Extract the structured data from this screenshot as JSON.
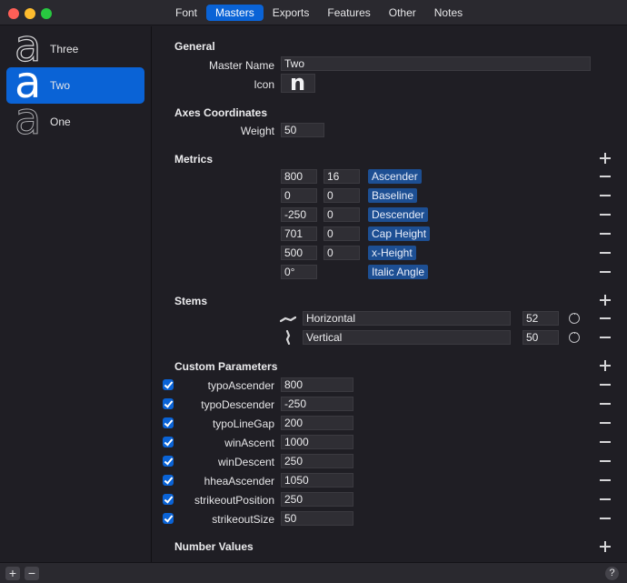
{
  "tabs": [
    {
      "label": "Font"
    },
    {
      "label": "Masters"
    },
    {
      "label": "Exports"
    },
    {
      "label": "Features"
    },
    {
      "label": "Other"
    },
    {
      "label": "Notes"
    }
  ],
  "active_tab": "Masters",
  "masters": [
    {
      "glyph": "a",
      "name": "Three",
      "selected": false
    },
    {
      "glyph": "a",
      "name": "Two",
      "selected": true
    },
    {
      "glyph": "a",
      "name": "One",
      "selected": false
    }
  ],
  "general": {
    "title": "General",
    "master_name_label": "Master Name",
    "master_name_value": "Two",
    "icon_label": "Icon",
    "icon_glyph": "n"
  },
  "axes": {
    "title": "Axes Coordinates",
    "weight_label": "Weight",
    "weight_value": "50"
  },
  "metrics": {
    "title": "Metrics",
    "rows": [
      {
        "value": "800",
        "overshoot": "16",
        "name": "Ascender"
      },
      {
        "value": "0",
        "overshoot": "0",
        "name": "Baseline"
      },
      {
        "value": "-250",
        "overshoot": "0",
        "name": "Descender"
      },
      {
        "value": "701",
        "overshoot": "0",
        "name": "Cap Height"
      },
      {
        "value": "500",
        "overshoot": "0",
        "name": "x-Height"
      },
      {
        "value": "0°",
        "overshoot": null,
        "name": "Italic Angle"
      }
    ]
  },
  "stems": {
    "title": "Stems",
    "rows": [
      {
        "icon": "horizontal-stem-icon",
        "name": "Horizontal",
        "value": "52"
      },
      {
        "icon": "vertical-stem-icon",
        "name": "Vertical",
        "value": "50"
      }
    ]
  },
  "custom_parameters": {
    "title": "Custom Parameters",
    "rows": [
      {
        "checked": true,
        "name": "typoAscender",
        "value": "800"
      },
      {
        "checked": true,
        "name": "typoDescender",
        "value": "-250"
      },
      {
        "checked": true,
        "name": "typoLineGap",
        "value": "200"
      },
      {
        "checked": true,
        "name": "winAscent",
        "value": "1000"
      },
      {
        "checked": true,
        "name": "winDescent",
        "value": "250"
      },
      {
        "checked": true,
        "name": "hheaAscender",
        "value": "1050"
      },
      {
        "checked": true,
        "name": "strikeoutPosition",
        "value": "250"
      },
      {
        "checked": true,
        "name": "strikeoutSize",
        "value": "50"
      }
    ]
  },
  "number_values": {
    "title": "Number Values"
  },
  "bottom": {
    "add_label": "+",
    "remove_label": "−",
    "help_label": "?"
  },
  "colors": {
    "accent": "#0a63d6",
    "tag": "#1d4f93",
    "background": "#1f1e24"
  }
}
